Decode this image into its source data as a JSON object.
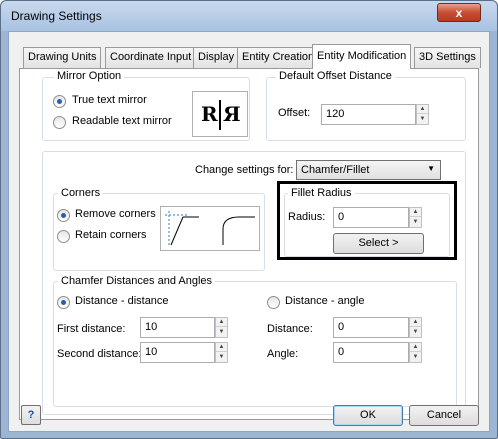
{
  "window": {
    "title": "Drawing Settings",
    "close_glyph": "x"
  },
  "tabs": [
    {
      "label": "Drawing Units"
    },
    {
      "label": "Coordinate Input"
    },
    {
      "label": "Display"
    },
    {
      "label": "Entity Creation"
    },
    {
      "label": "Entity Modification"
    },
    {
      "label": "3D Settings"
    }
  ],
  "mirror": {
    "legend": "Mirror Option",
    "option1": "True text mirror",
    "option2": "Readable text mirror",
    "preview_left": "R",
    "preview_right": "Я"
  },
  "offset": {
    "legend": "Default Offset Distance",
    "label": "Offset:",
    "value": "120"
  },
  "change_settings": {
    "label": "Change settings for:",
    "selected": "Chamfer/Fillet"
  },
  "corners": {
    "legend": "Corners",
    "option1": "Remove corners",
    "option2": "Retain corners"
  },
  "fillet": {
    "legend": "Fillet Radius",
    "label": "Radius:",
    "value": "0",
    "select_label": "Select >"
  },
  "chamfer": {
    "legend": "Chamfer Distances and Angles",
    "opt_dd": "Distance - distance",
    "opt_da": "Distance - angle",
    "first_label": "First distance:",
    "first_value": "10",
    "second_label": "Second distance:",
    "second_value": "10",
    "distance_label": "Distance:",
    "distance_value": "0",
    "angle_label": "Angle:",
    "angle_value": "0"
  },
  "footer": {
    "help": "?",
    "ok": "OK",
    "cancel": "Cancel"
  }
}
